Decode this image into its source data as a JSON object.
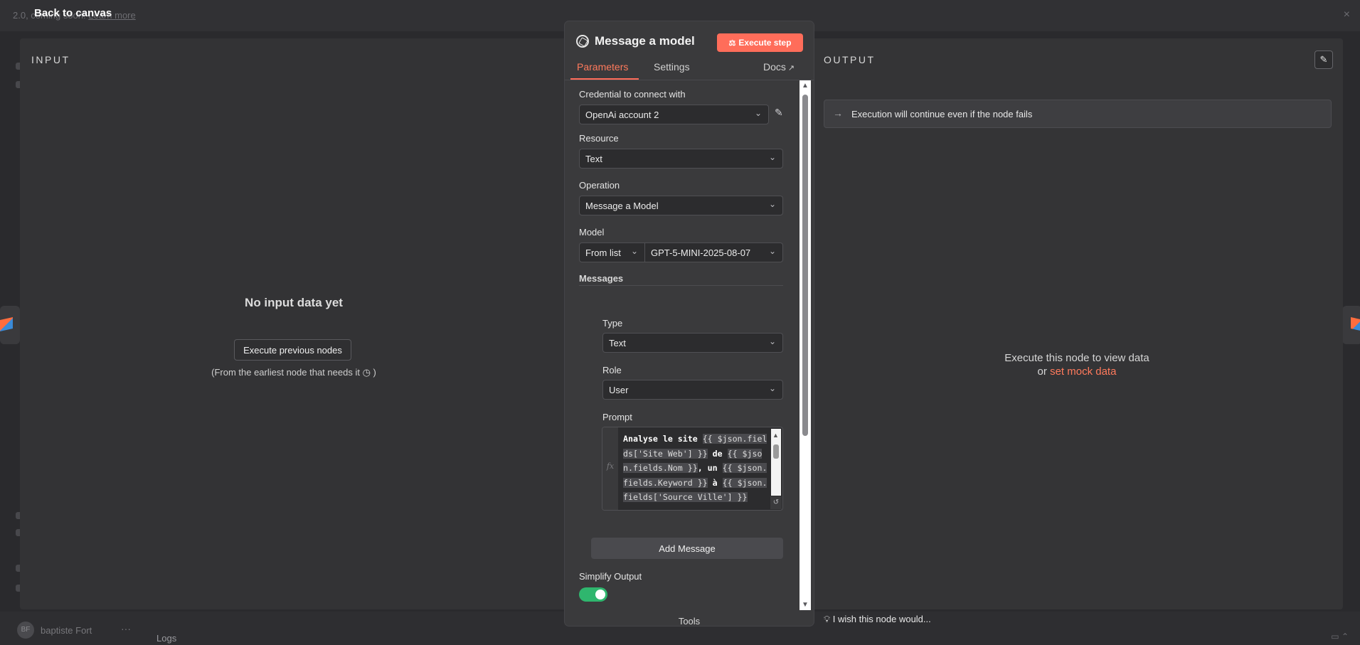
{
  "background": {
    "banner": {
      "text": "2.0, coming soon!",
      "link": "Learn more"
    },
    "back_to_canvas": "Back to canvas",
    "user_initials": "BF",
    "user_name": "baptiste Fort",
    "menu": "···",
    "logs_label": "Logs"
  },
  "input_panel": {
    "title": "INPUT",
    "empty_title": "No input data yet",
    "execute_previous": "Execute previous nodes",
    "hint": "(From the earliest node that needs it",
    "hint_suffix": ")"
  },
  "node": {
    "title": "Message a model",
    "execute_step": "Execute step",
    "tabs": {
      "parameters": "Parameters",
      "settings": "Settings",
      "docs": "Docs"
    },
    "fields": {
      "credential": {
        "label": "Credential to connect with",
        "value": "OpenAi account 2"
      },
      "resource": {
        "label": "Resource",
        "value": "Text"
      },
      "operation": {
        "label": "Operation",
        "value": "Message a Model"
      },
      "model": {
        "label": "Model",
        "mode": "From list",
        "value": "GPT-5-MINI-2025-08-07"
      },
      "messages": {
        "label": "Messages",
        "type": {
          "label": "Type",
          "value": "Text"
        },
        "role": {
          "label": "Role",
          "value": "User"
        },
        "prompt": {
          "label": "Prompt",
          "fx": "fx",
          "part1": "Analyse le site ",
          "expr1": "{{ $json.fields['Site Web'] }}",
          "part2": " de ",
          "expr2": "{{ $json.fields.Nom }}",
          "part3": ", un ",
          "expr3": "{{ $json.fields.Keyword }}",
          "part4": " à ",
          "expr4": "{{ $json.fields['Source Ville'] }}"
        }
      },
      "add_message": "Add Message",
      "simplify_output": {
        "label": "Simplify Output",
        "value": true
      }
    },
    "tools_label": "Tools",
    "tools_add": "+"
  },
  "output_panel": {
    "title": "OUTPUT",
    "continue_notice": "Execution will continue even if the node fails",
    "execute_hint": "Execute this node to view data",
    "or": "or",
    "mock_link": "set mock data",
    "wish": "I wish this node would..."
  },
  "colors": {
    "accent": "#ff6d5a",
    "toggle_on": "#2fb66e",
    "panel_bg": "#333335"
  },
  "icons": [
    "openai-icon",
    "flask-icon",
    "external-link-icon",
    "chevron-down-icon",
    "pencil-icon",
    "arrow-right-icon",
    "lightbulb-icon",
    "clock-icon",
    "plus-icon"
  ]
}
